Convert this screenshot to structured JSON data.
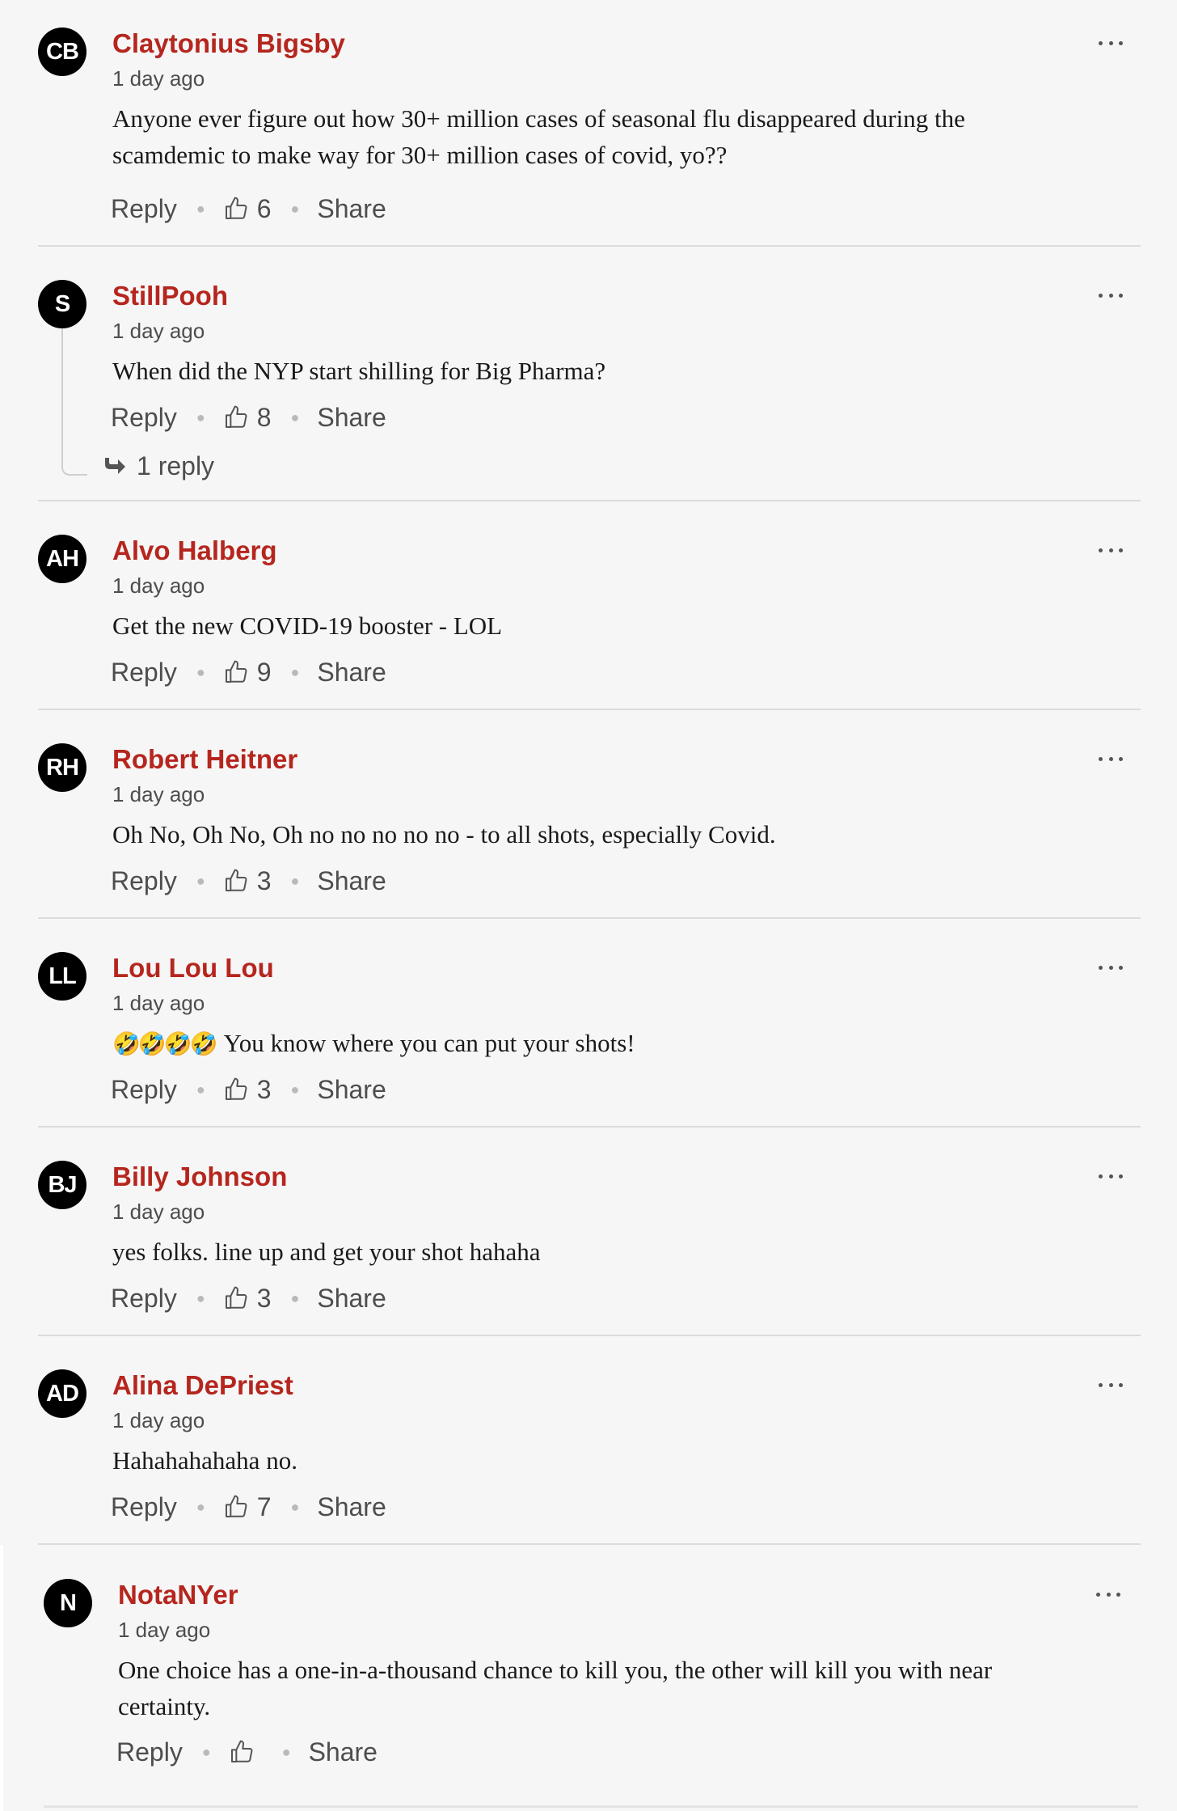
{
  "actions": {
    "reply": "Reply",
    "share": "Share"
  },
  "comments": [
    {
      "initials": "CB",
      "author": "Claytonius Bigsby",
      "time": "1 day ago",
      "text": "Anyone ever figure out how 30+ million cases of seasonal flu disappeared during the scamdemic to make way for 30+ million cases of covid, yo??",
      "likes": "6"
    },
    {
      "initials": "S",
      "author": "StillPooh",
      "time": "1 day ago",
      "text": "When did the NYP start shilling for Big Pharma?",
      "likes": "8",
      "replies": "1 reply"
    },
    {
      "initials": "AH",
      "author": "Alvo Halberg",
      "time": "1 day ago",
      "text": "Get the new COVID-19 booster - LOL",
      "likes": "9"
    },
    {
      "initials": "RH",
      "author": "Robert Heitner",
      "time": "1 day ago",
      "text": "Oh No, Oh No, Oh no no no no no - to all shots, especially Covid.",
      "likes": "3"
    },
    {
      "initials": "LL",
      "author": "Lou Lou Lou",
      "time": "1 day ago",
      "emoji": "🤣🤣🤣🤣",
      "text": "You know where you can put your shots!",
      "likes": "3"
    },
    {
      "initials": "BJ",
      "author": "Billy Johnson",
      "time": "1 day ago",
      "text": "yes folks. line up and get your shot hahaha",
      "likes": "3"
    },
    {
      "initials": "AD",
      "author": "Alina DePriest",
      "time": "1 day ago",
      "text": "Hahahahahaha no.",
      "likes": "7"
    },
    {
      "initials": "N",
      "author": "NotaNYer",
      "time": "1 day ago",
      "text": "One choice has a one-in-a-thousand chance to kill you, the other will kill you with near certainty.",
      "likes": ""
    }
  ],
  "colors": {
    "author": "#b5261e",
    "avatar_bg": "#000000",
    "page_bg": "#f6f6f6"
  },
  "icons": {
    "like": "thumbs-up-icon",
    "more": "more-dots-icon",
    "replies": "reply-arrow-icon"
  }
}
